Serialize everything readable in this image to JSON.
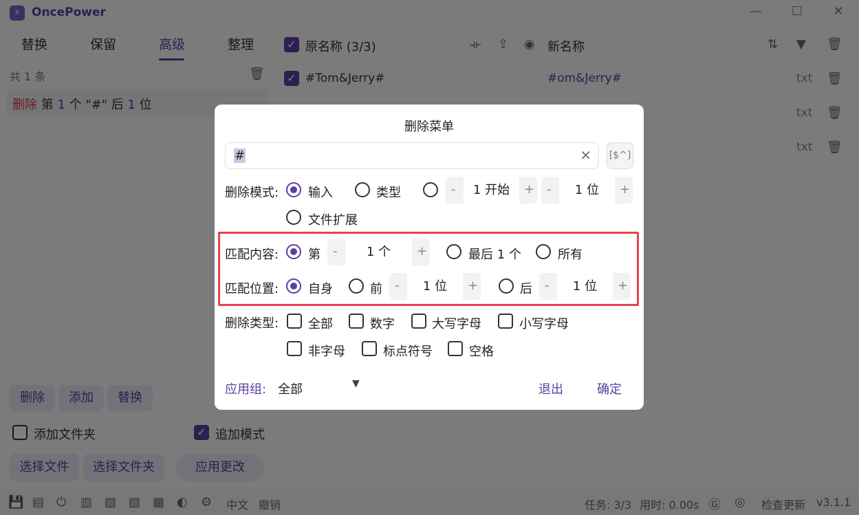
{
  "app": {
    "title": "OncePower",
    "logo_glyph": "⚡"
  },
  "window": {
    "minimize": "—",
    "maximize": "☐",
    "close": "✕"
  },
  "tabs": [
    "替换",
    "保留",
    "高级",
    "整理"
  ],
  "left": {
    "count": "共 1 条",
    "rule": {
      "action": "删除",
      "text1": " 第 ",
      "n": "1",
      "text2": " 个 \"#\" 后 ",
      "m": "1",
      "text3": " 位"
    },
    "buttons": [
      "删除",
      "添加",
      "替换"
    ],
    "add_folder": "添加文件夹",
    "append_mode": "追加模式",
    "select_file": "选择文件",
    "select_folder": "选择文件夹",
    "apply": "应用更改"
  },
  "files": {
    "header_original": "原名称 (3/3)",
    "header_new": "新名称",
    "rows": [
      {
        "original": "#Tom&Jerry#",
        "new": "#om&Jerry#",
        "ext": "txt"
      },
      {
        "original": "",
        "new": "",
        "ext": "txt"
      },
      {
        "original": "",
        "new": "",
        "ext": "txt"
      }
    ]
  },
  "modal": {
    "title": "删除菜单",
    "input_value": "#",
    "regex_icon": "[$^]",
    "mode_label": "删除模式:",
    "mode_input": "输入",
    "mode_type": "类型",
    "start_value": "1 开始",
    "count_value": "1 位",
    "mode_ext": "文件扩展",
    "match_label": "匹配内容:",
    "match_nth": "第",
    "match_nth_value": "1 个",
    "match_last": "最后 1 个",
    "match_all": "所有",
    "pos_label": "匹配位置:",
    "pos_self": "自身",
    "pos_before": "前",
    "pos_before_value": "1 位",
    "pos_after": "后",
    "pos_after_value": "1 位",
    "type_label": "删除类型:",
    "types": [
      "全部",
      "数字",
      "大写字母",
      "小写字母",
      "非字母",
      "标点符号",
      "空格"
    ],
    "group_label": "应用组:",
    "group_value": "全部",
    "exit": "退出",
    "confirm": "确定",
    "minus": "-",
    "plus": "+"
  },
  "status": {
    "lang": "中文",
    "undo": "撤销",
    "tasks": "任务: 3/3",
    "time": "用时: 0.00s",
    "check_update": "检查更新",
    "version": "v3.1.1"
  }
}
